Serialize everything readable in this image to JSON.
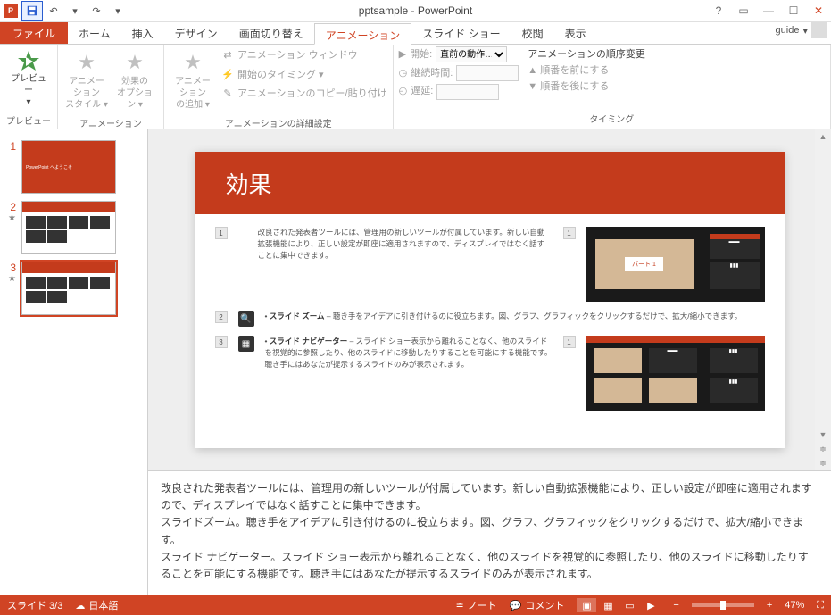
{
  "title": "pptsample - PowerPoint",
  "qat": {
    "undo": "↶",
    "redo": "↷"
  },
  "window": {
    "help": "?",
    "ribbon_opts": "▭",
    "min": "—",
    "max": "☐",
    "close": "✕"
  },
  "user": {
    "name": "guide",
    "dropdown": "▾"
  },
  "tabs": {
    "file": "ファイル",
    "home": "ホーム",
    "insert": "挿入",
    "design": "デザイン",
    "transitions": "画面切り替え",
    "animations": "アニメーション",
    "slideshow": "スライド ショー",
    "review": "校閲",
    "view": "表示"
  },
  "ribbon": {
    "preview": {
      "label": "プレビュー",
      "group": "プレビュー",
      "drop": "▾"
    },
    "anim": {
      "style": "アニメーション\nスタイル ▾",
      "options": "効果の\nオプション ▾",
      "group": "アニメーション"
    },
    "advanced": {
      "add": "アニメーション\nの追加 ▾",
      "pane": "アニメーション ウィンドウ",
      "trigger": "開始のタイミング ▾",
      "painter": "アニメーションのコピー/貼り付け",
      "group": "アニメーションの詳細設定"
    },
    "timing": {
      "start": "開始:",
      "start_val": "直前の動作…",
      "duration": "継続時間:",
      "delay": "遅延:",
      "reorder": "アニメーションの順序変更",
      "before": "順番を前にする",
      "after": "順番を後にする",
      "group": "タイミング",
      "play": "▶",
      "clock": "◷",
      "delay_icon": "◵",
      "up": "▲",
      "down": "▼"
    }
  },
  "thumbs": {
    "n1": "1",
    "n2": "2",
    "n3": "3"
  },
  "slide": {
    "title": "効果",
    "num1": "1",
    "num2": "2",
    "num3": "3",
    "p1": "改良された発表者ツールには、管理用の新しいツールが付属しています。新しい自動拡張機能により、正しい設定が即座に適用されますので、ディスプレイではなく話すことに集中できます。",
    "p2a": "スライド ズーム",
    "p2b": " – 聴き手をアイデアに引き付けるのに役立ちます。図、グラフ、グラフィックをクリックするだけで、拡大/縮小できます。",
    "p3a": "スライド ナビゲーター",
    "p3b": " – スライド ショー表示から離れることなく、他のスライドを視覚的に参照したり、他のスライドに移動したりすることを可能にする機能です。聴き手にはあなたが提示するスライドのみが表示されます。",
    "mock_label": "パート 1",
    "zoom_icon": "🔍",
    "nav_icon": "▦"
  },
  "notes": {
    "l1": "改良された発表者ツールには、管理用の新しいツールが付属しています。新しい自動拡張機能により、正しい設定が即座に適用されますので、ディスプレイではなく話すことに集中できます。",
    "l2": "スライドズーム。聴き手をアイデアに引き付けるのに役立ちます。図、グラフ、グラフィックをクリックするだけで、拡大/縮小できます。",
    "l3": "スライド ナビゲーター。スライド ショー表示から離れることなく、他のスライドを視覚的に参照したり、他のスライドに移動したりすることを可能にする機能です。聴き手にはあなたが提示するスライドのみが表示されます。"
  },
  "status": {
    "slide": "スライド 3/3",
    "lang": "日本語",
    "lang_icon": "☁",
    "notes": "ノート",
    "notes_icon": "≐",
    "comments": "コメント",
    "comments_icon": "💬",
    "zoom": "47%",
    "minus": "−",
    "plus": "+",
    "fit": "⛶"
  },
  "scroll": {
    "up": "▲",
    "down": "▼",
    "dup": "≑",
    "ddown": "≑"
  }
}
